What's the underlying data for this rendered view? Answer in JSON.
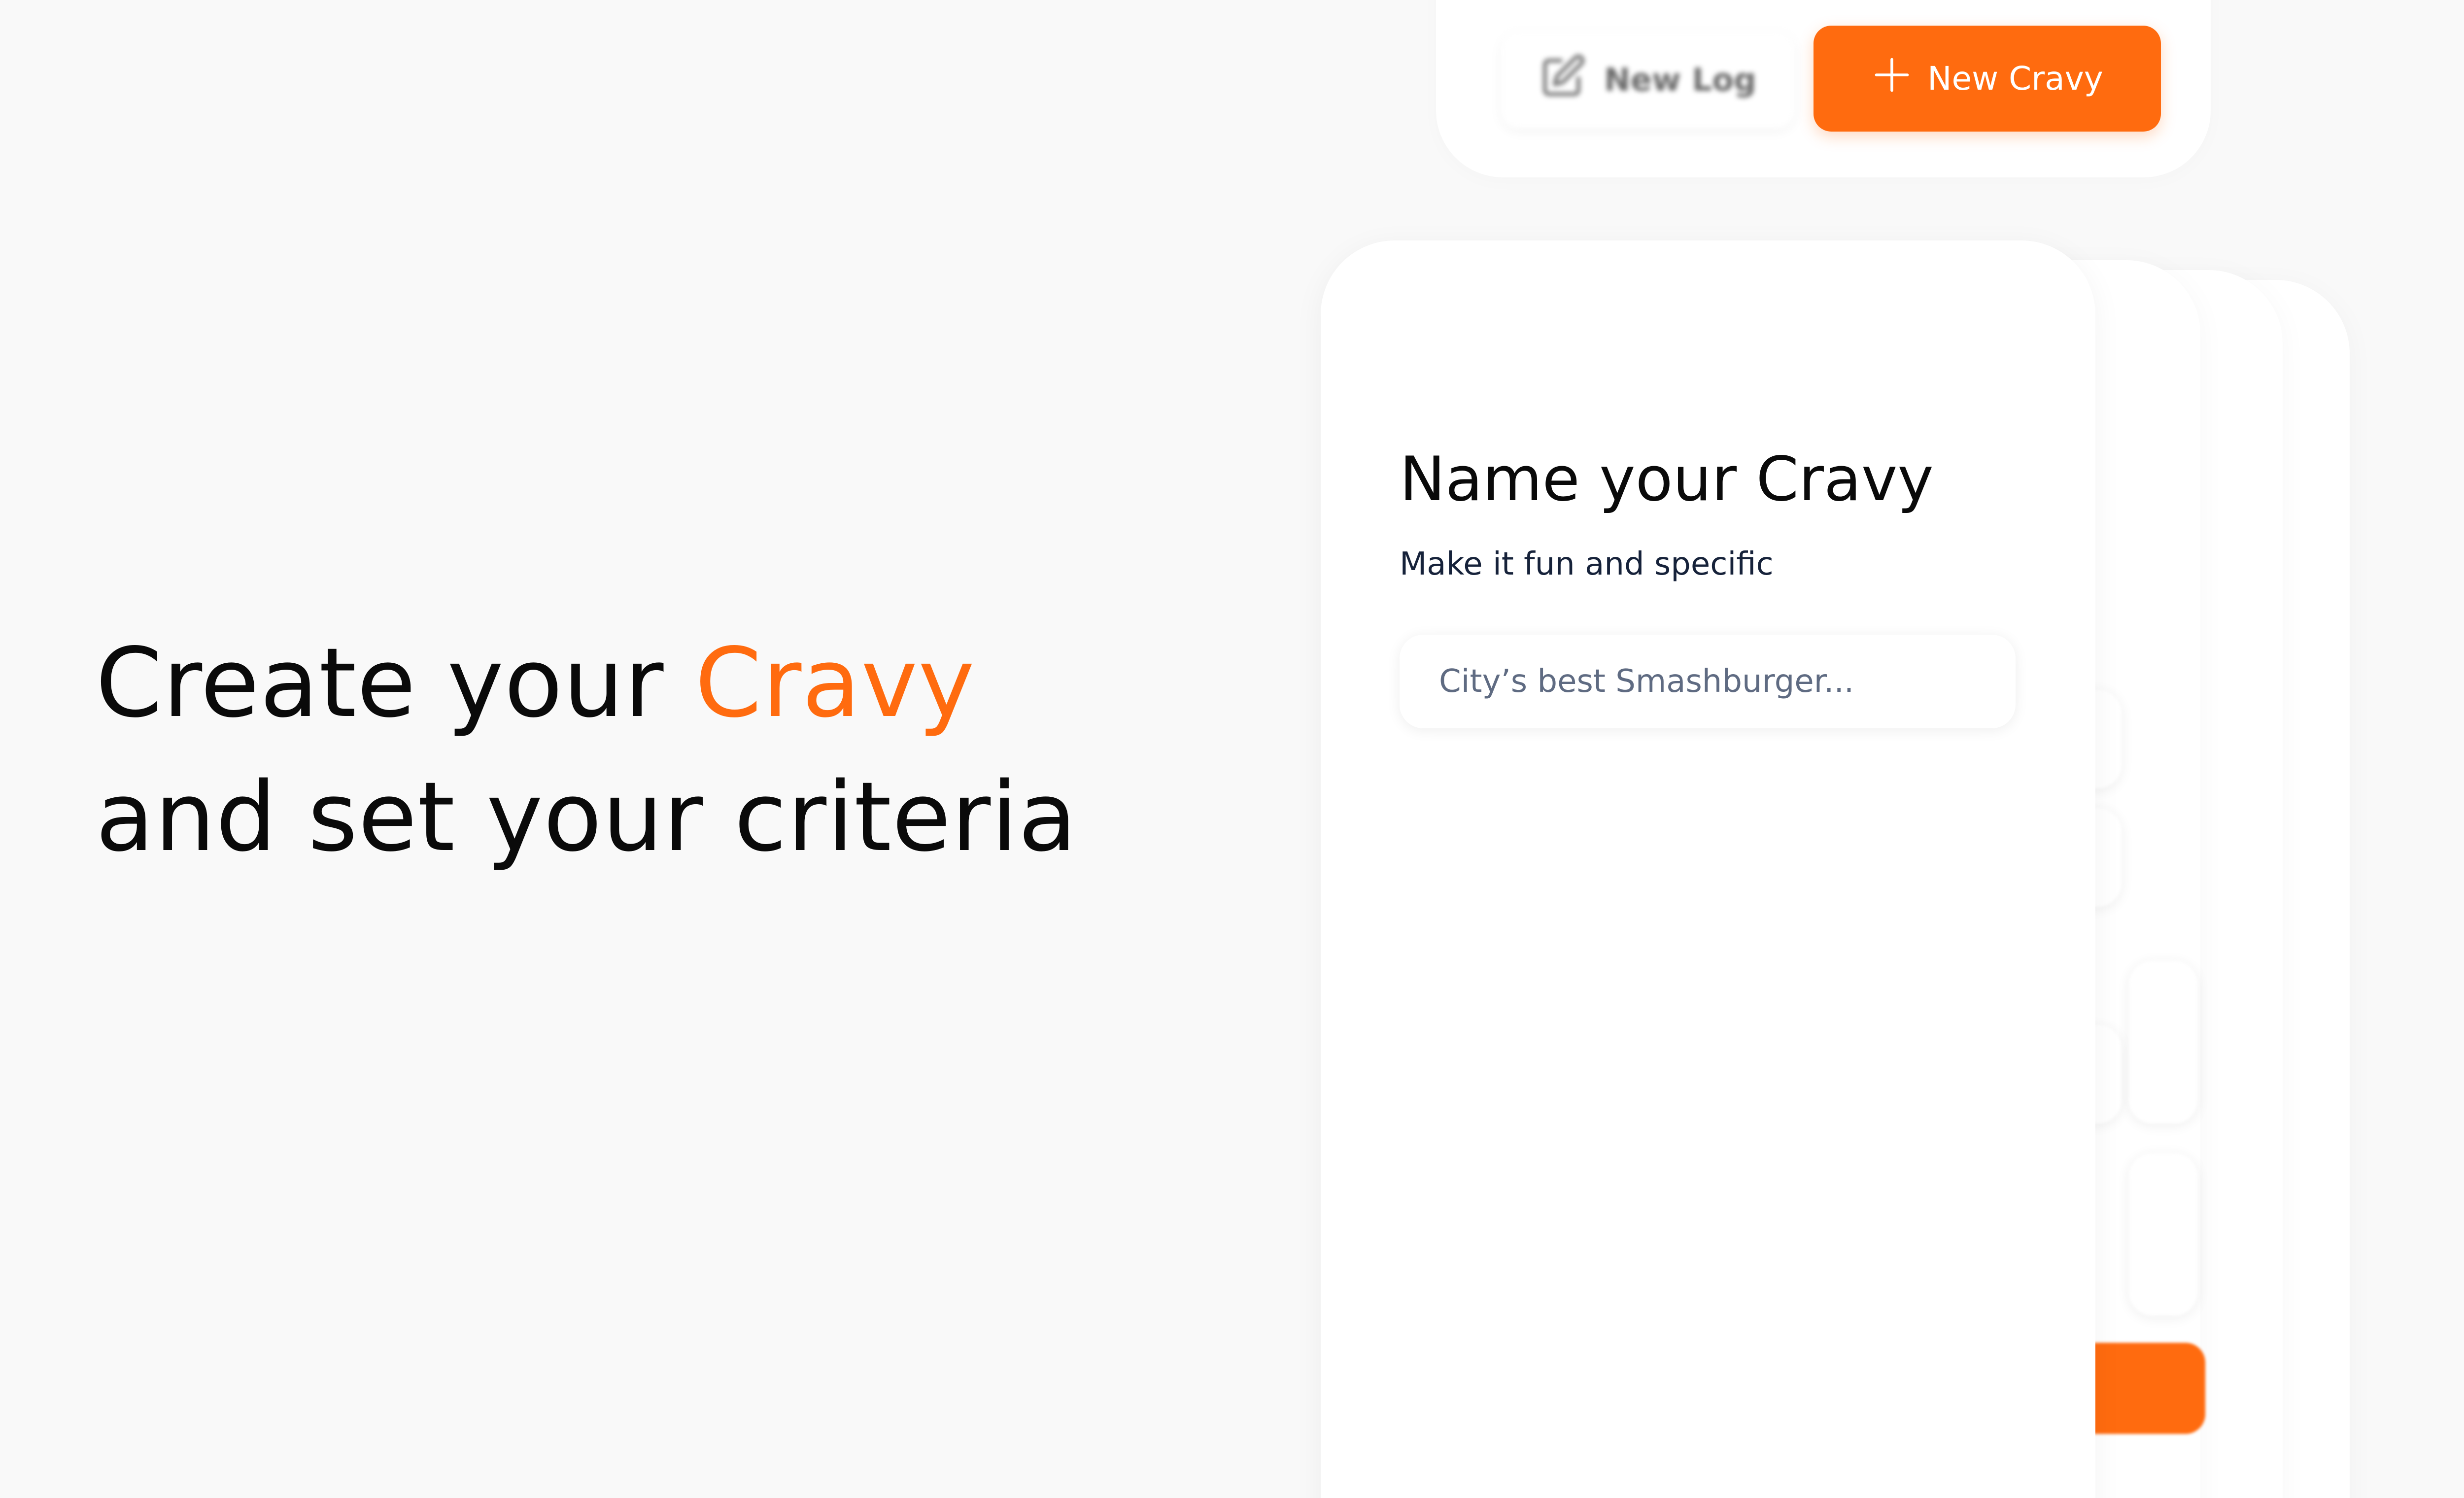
{
  "headline": {
    "line1_prefix": "Create your",
    "line1_accent": "Cravy",
    "line2": "and set your criteria"
  },
  "toolbar": {
    "new_log_label": "New Log",
    "new_log_icon": "edit-square-icon",
    "new_cravy_label": "New Cravy",
    "new_cravy_icon": "plus-icon"
  },
  "card": {
    "title": "Name your Cravy",
    "subtitle": "Make it fun and specific",
    "name_input": {
      "value": "",
      "placeholder": "City’s best Smashburger..."
    }
  },
  "colors": {
    "accent": "#ff6b0f",
    "background": "#f9f9f9",
    "card": "#ffffff",
    "text": "#0a0a0a",
    "placeholder": "#5f6b82"
  }
}
